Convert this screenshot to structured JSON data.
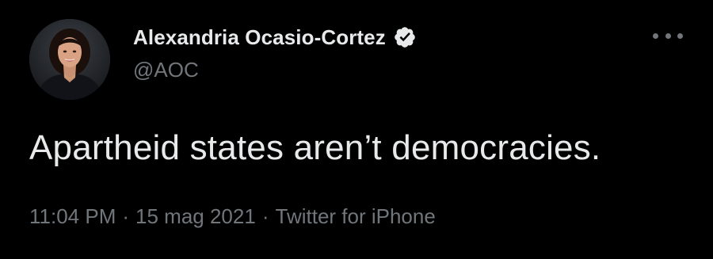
{
  "author": {
    "name": "Alexandria Ocasio-Cortez",
    "handle": "@AOC",
    "verified_icon": "verified-badge-icon"
  },
  "tweet": {
    "text": "Apartheid states aren’t democracies.",
    "time": "11:04 PM",
    "separator": "·",
    "date": "15 mag 2021",
    "source": "Twitter for iPhone"
  },
  "icons": {
    "more": "more-options-icon"
  },
  "colors": {
    "background": "#000000",
    "primary_text": "#e7e9ea",
    "secondary_text": "#71767b"
  }
}
